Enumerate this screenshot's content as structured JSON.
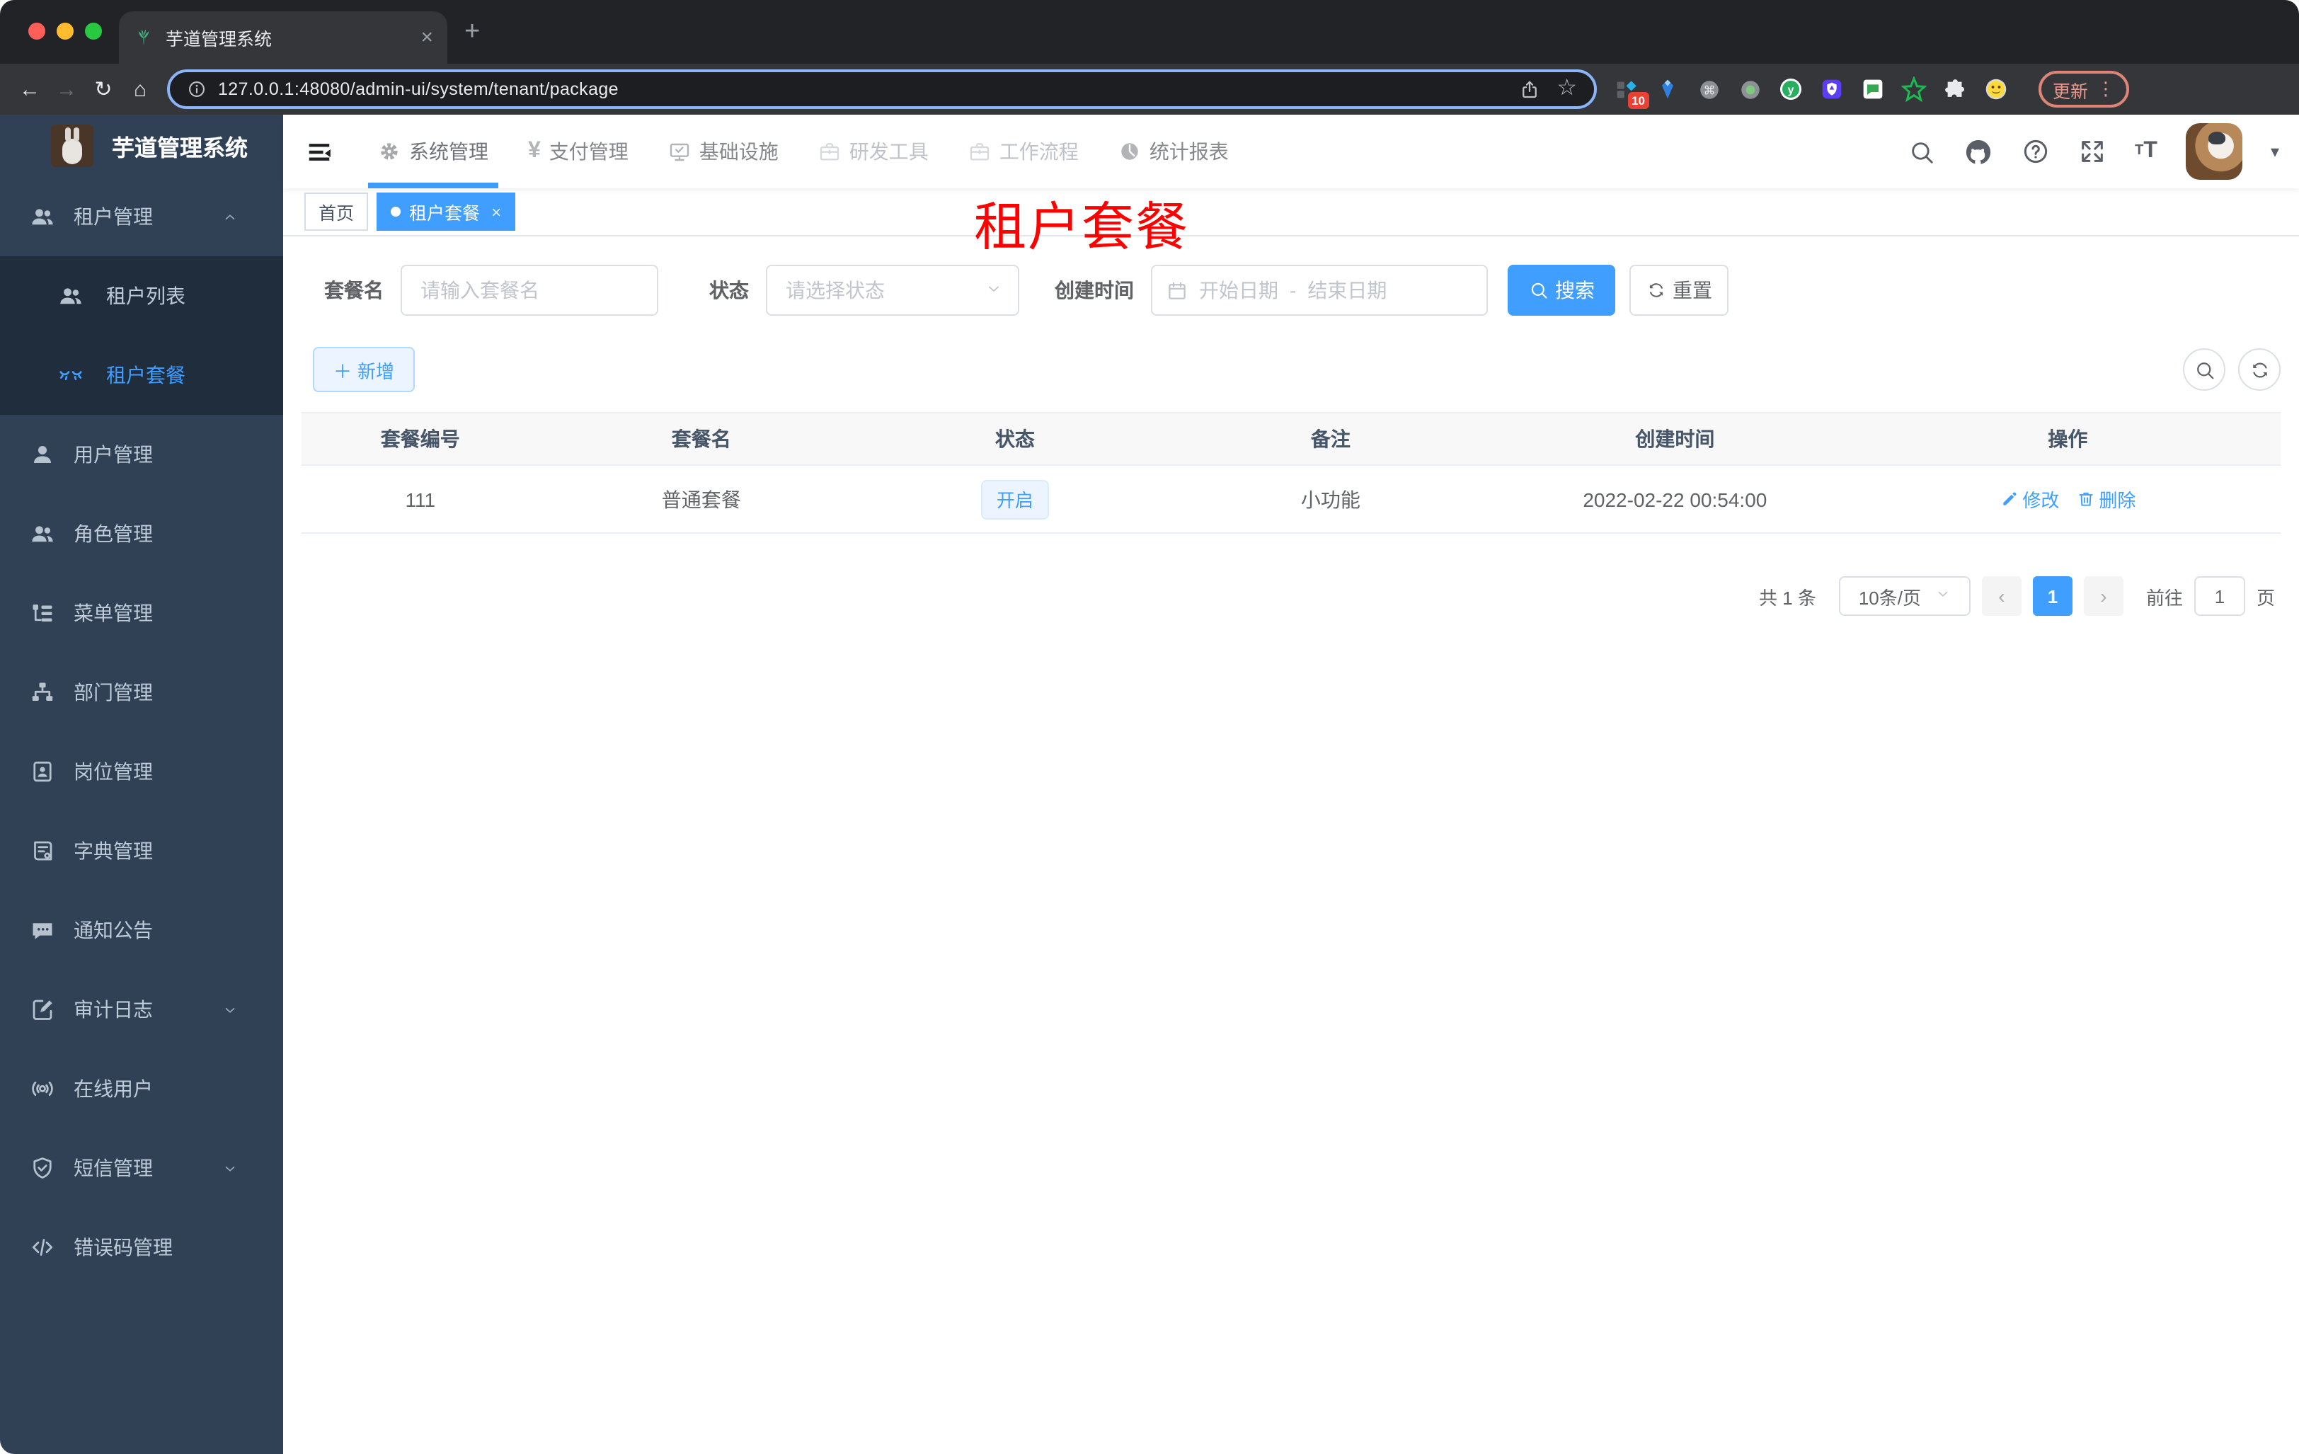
{
  "browser": {
    "tab_title": "芋道管理系统",
    "url": "127.0.0.1:48080/admin-ui/system/tenant/package",
    "ext_badge_count": "10",
    "update_button_label": "更新",
    "close_tab_glyph": "×",
    "new_tab_glyph": "+"
  },
  "header": {
    "nav": [
      {
        "label": "系统管理",
        "icon": "gear-icon",
        "state": "active"
      },
      {
        "label": "支付管理",
        "icon": "yen-icon",
        "state": "normal"
      },
      {
        "label": "基础设施",
        "icon": "monitor-icon",
        "state": "normal"
      },
      {
        "label": "研发工具",
        "icon": "briefcase-icon",
        "state": "muted"
      },
      {
        "label": "工作流程",
        "icon": "briefcase-icon",
        "state": "muted"
      },
      {
        "label": "统计报表",
        "icon": "chart-icon",
        "state": "normal"
      }
    ]
  },
  "sidebar": {
    "logo_title": "芋道管理系统",
    "menu": [
      {
        "label": "租户管理",
        "icon": "users-icon",
        "level": 1,
        "arrow": "up"
      },
      {
        "label": "租户列表",
        "icon": "users-icon",
        "level": 2
      },
      {
        "label": "租户套餐",
        "icon": "closed-eye-icon",
        "level": 2,
        "active": true
      },
      {
        "label": "用户管理",
        "icon": "user-icon",
        "level": 1
      },
      {
        "label": "角色管理",
        "icon": "users-icon",
        "level": 1
      },
      {
        "label": "菜单管理",
        "icon": "menu-tree-icon",
        "level": 1
      },
      {
        "label": "部门管理",
        "icon": "org-icon",
        "level": 1
      },
      {
        "label": "岗位管理",
        "icon": "badge-icon",
        "level": 1
      },
      {
        "label": "字典管理",
        "icon": "dict-icon",
        "level": 1
      },
      {
        "label": "通知公告",
        "icon": "message-icon",
        "level": 1
      },
      {
        "label": "审计日志",
        "icon": "log-icon",
        "level": 1,
        "arrow": "down"
      },
      {
        "label": "在线用户",
        "icon": "online-icon",
        "level": 1
      },
      {
        "label": "短信管理",
        "icon": "shield-icon",
        "level": 1,
        "arrow": "down"
      },
      {
        "label": "错误码管理",
        "icon": "code-icon",
        "level": 1
      }
    ]
  },
  "tags": [
    {
      "label": "首页",
      "active": false
    },
    {
      "label": "租户套餐",
      "active": true,
      "closable": true
    }
  ],
  "page_title_watermark": "租户套餐",
  "filters": {
    "name_label": "套餐名",
    "name_placeholder": "请输入套餐名",
    "status_label": "状态",
    "status_placeholder": "请选择状态",
    "date_label": "创建时间",
    "date_start_placeholder": "开始日期",
    "date_separator": "-",
    "date_end_placeholder": "结束日期",
    "search_button": "搜索",
    "reset_button": "重置"
  },
  "toolbar": {
    "add_button": "新增"
  },
  "table": {
    "columns": [
      "套餐编号",
      "套餐名",
      "状态",
      "备注",
      "创建时间",
      "操作"
    ],
    "rows": [
      {
        "id": "111",
        "name": "普通套餐",
        "status": "开启",
        "remark": "小功能",
        "created_at": "2022-02-22 00:54:00",
        "actions": [
          {
            "label": "修改",
            "icon": "edit-icon"
          },
          {
            "label": "删除",
            "icon": "trash-icon"
          }
        ]
      }
    ]
  },
  "pagination": {
    "total": "共 1 条",
    "page_size": "10条/页",
    "prev_glyph": "‹",
    "current_page": "1",
    "next_glyph": "›",
    "goto_label": "前往",
    "goto_value": "1",
    "goto_unit": "页"
  },
  "colors": {
    "accent": "#409eff",
    "sidebar_bg": "#304156",
    "submenu_bg": "#1f2d3d",
    "watermark_red": "#ff0000",
    "active_underline": "#3d9bfa"
  }
}
